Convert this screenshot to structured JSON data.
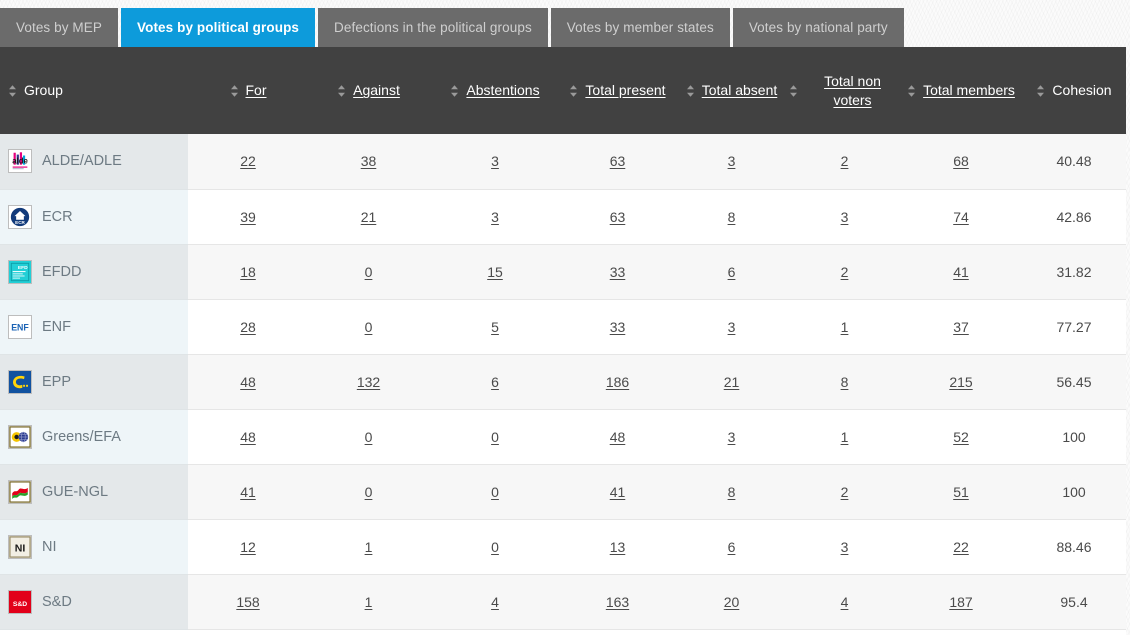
{
  "tabs": [
    {
      "label": "Votes by MEP",
      "active": false
    },
    {
      "label": "Votes by political groups",
      "active": true
    },
    {
      "label": "Defections in the political groups",
      "active": false
    },
    {
      "label": "Votes by member states",
      "active": false
    },
    {
      "label": "Votes by national party",
      "active": false
    }
  ],
  "table": {
    "columns": [
      {
        "label": "Group",
        "sortable": true,
        "underline": false,
        "align": "left"
      },
      {
        "label": "For",
        "sortable": true,
        "underline": true,
        "align": "center"
      },
      {
        "label": "Against",
        "sortable": true,
        "underline": true,
        "align": "center"
      },
      {
        "label": "Abstentions",
        "sortable": true,
        "underline": true,
        "align": "center"
      },
      {
        "label": "Total present",
        "sortable": true,
        "underline": true,
        "align": "center"
      },
      {
        "label": "Total absent",
        "sortable": true,
        "underline": true,
        "align": "center"
      },
      {
        "label": "Total non voters",
        "sortable": true,
        "underline": true,
        "align": "center"
      },
      {
        "label": "Total members",
        "sortable": true,
        "underline": true,
        "align": "center"
      },
      {
        "label": "Cohesion",
        "sortable": true,
        "underline": false,
        "align": "center"
      }
    ],
    "rows": [
      {
        "group": "ALDE/ADLE",
        "logo": "alde-logo",
        "for": "22",
        "against": "38",
        "abstentions": "3",
        "total_present": "63",
        "total_absent": "3",
        "total_non_voters": "2",
        "total_members": "68",
        "cohesion": "40.48"
      },
      {
        "group": "ECR",
        "logo": "ecr-logo",
        "for": "39",
        "against": "21",
        "abstentions": "3",
        "total_present": "63",
        "total_absent": "8",
        "total_non_voters": "3",
        "total_members": "74",
        "cohesion": "42.86"
      },
      {
        "group": "EFDD",
        "logo": "efdd-logo",
        "for": "18",
        "against": "0",
        "abstentions": "15",
        "total_present": "33",
        "total_absent": "6",
        "total_non_voters": "2",
        "total_members": "41",
        "cohesion": "31.82"
      },
      {
        "group": "ENF",
        "logo": "enf-logo",
        "for": "28",
        "against": "0",
        "abstentions": "5",
        "total_present": "33",
        "total_absent": "3",
        "total_non_voters": "1",
        "total_members": "37",
        "cohesion": "77.27"
      },
      {
        "group": "EPP",
        "logo": "epp-logo",
        "for": "48",
        "against": "132",
        "abstentions": "6",
        "total_present": "186",
        "total_absent": "21",
        "total_non_voters": "8",
        "total_members": "215",
        "cohesion": "56.45"
      },
      {
        "group": "Greens/EFA",
        "logo": "greens-efa-logo",
        "for": "48",
        "against": "0",
        "abstentions": "0",
        "total_present": "48",
        "total_absent": "3",
        "total_non_voters": "1",
        "total_members": "52",
        "cohesion": "100"
      },
      {
        "group": "GUE-NGL",
        "logo": "gue-ngl-logo",
        "for": "41",
        "against": "0",
        "abstentions": "0",
        "total_present": "41",
        "total_absent": "8",
        "total_non_voters": "2",
        "total_members": "51",
        "cohesion": "100"
      },
      {
        "group": "NI",
        "logo": "ni-logo",
        "for": "12",
        "against": "1",
        "abstentions": "0",
        "total_present": "13",
        "total_absent": "6",
        "total_non_voters": "3",
        "total_members": "22",
        "cohesion": "88.46"
      },
      {
        "group": "S&D",
        "logo": "sd-logo",
        "for": "158",
        "against": "1",
        "abstentions": "4",
        "total_present": "163",
        "total_absent": "20",
        "total_non_voters": "4",
        "total_members": "187",
        "cohesion": "95.4"
      }
    ]
  },
  "colors": {
    "tab_active": "#0d9bdb",
    "tab_inactive": "#6b6b6b",
    "header_bar": "#414141",
    "row_alt": "#f7f7f7",
    "group_col_even": "#eef5f8",
    "group_col_odd": "#e4e8ea"
  }
}
